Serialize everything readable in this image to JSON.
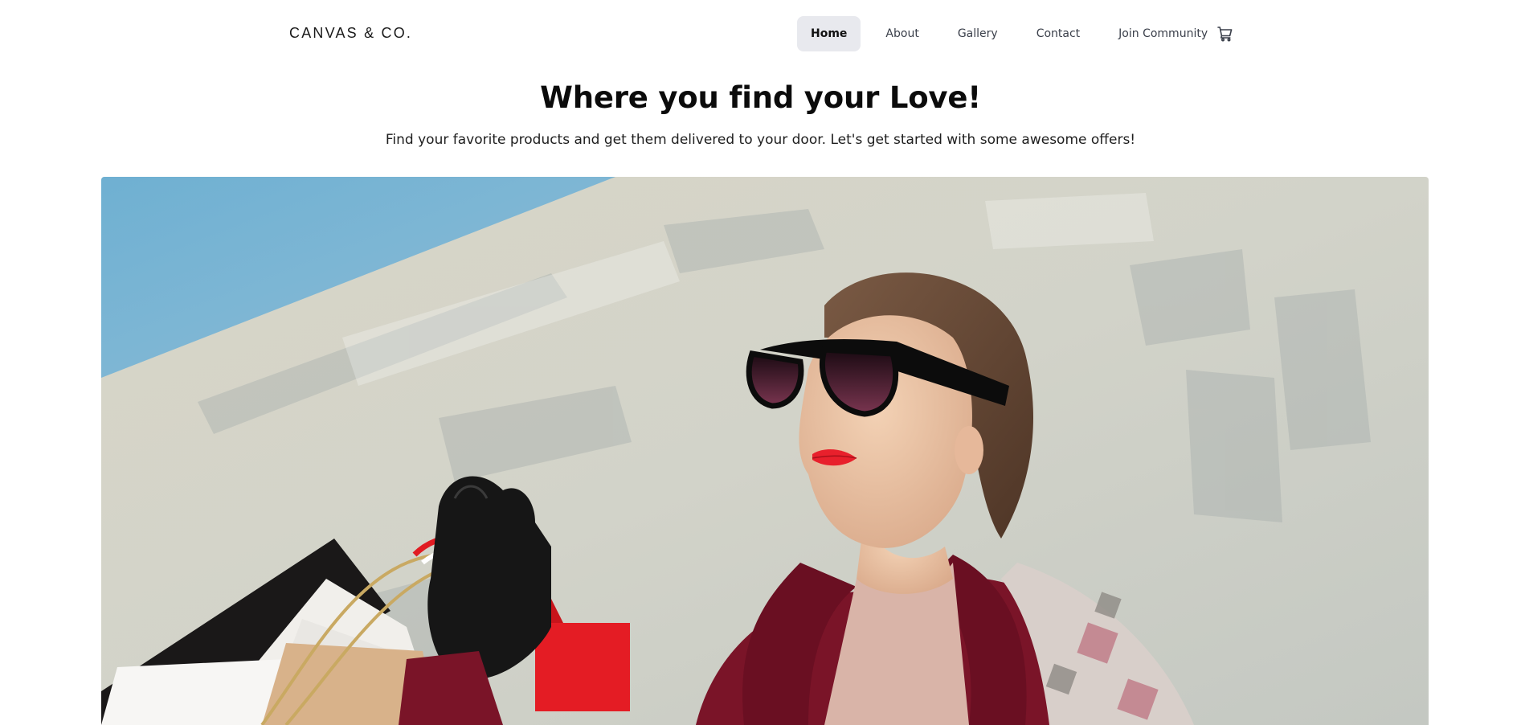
{
  "brand": {
    "name": "CANVAS & CO."
  },
  "nav": {
    "items": [
      {
        "label": "Home",
        "active": true
      },
      {
        "label": "About",
        "active": false
      },
      {
        "label": "Gallery",
        "active": false
      },
      {
        "label": "Contact",
        "active": false
      },
      {
        "label": "Join Community",
        "active": false
      }
    ],
    "cart_icon": "shopping-cart-icon"
  },
  "hero": {
    "title": "Where you find your Love!",
    "subtitle": "Find your favorite products and get them delivered to your door. Let's get started with some awesome offers!",
    "image_alt": "Woman in sunglasses holding shopping bags"
  },
  "colors": {
    "nav_active_bg": "#e8e9ee",
    "text": "#111111",
    "sky": "#7ab3d3",
    "lipstick": "#e8202c",
    "coat": "#7a1428"
  }
}
